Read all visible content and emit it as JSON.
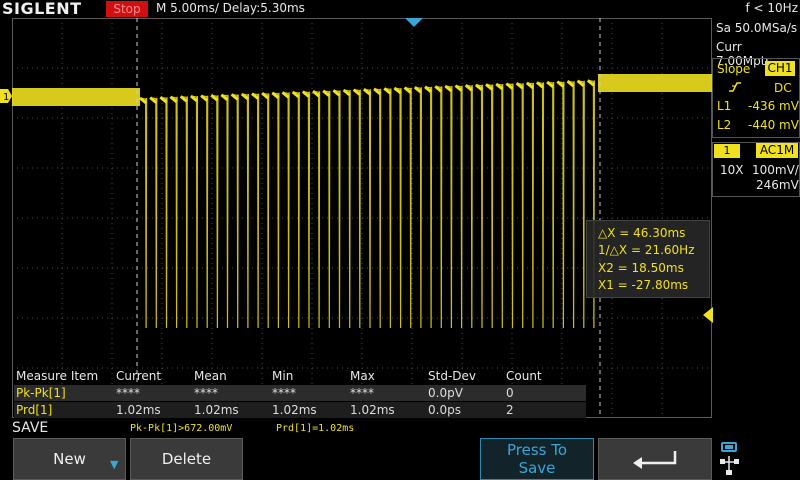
{
  "header": {
    "logo": "SIGLENT",
    "run_state": "Stop",
    "timebase": "M 5.00ms/ Delay:5.30ms",
    "trigger_freq": "f < 10Hz"
  },
  "acquisition": {
    "sample_rate": "Sa 50.0MSa/s",
    "memory_depth": "Curr 7.00Mpts"
  },
  "trigger": {
    "type": "Slope",
    "source": "CH1",
    "slope_icon": "rising-slope-icon",
    "coupling": "DC",
    "l1_label": "L1",
    "l1_value": "-436 mV",
    "l2_label": "L2",
    "l2_value": "-440 mV"
  },
  "channel": {
    "number": "1",
    "coupling": "AC1M",
    "probe": "10X",
    "scale": "100mV/",
    "offset": "246mV",
    "marker": "1"
  },
  "cursors": {
    "delta_x": "△X = 46.30ms",
    "inv_delta_x": "1/△X = 21.60Hz",
    "x2": "X2 = 18.50ms",
    "x1": "X1 = -27.80ms"
  },
  "measure": {
    "headers": [
      "Measure Item",
      "Current",
      "Mean",
      "Min",
      "Max",
      "Std-Dev",
      "Count"
    ],
    "rows": [
      {
        "item": "Pk-Pk[1]",
        "current": "****",
        "mean": "****",
        "min": "****",
        "max": "****",
        "std_dev": "0.0pV",
        "count": "0"
      },
      {
        "item": "Prd[1]",
        "current": "1.02ms",
        "mean": "1.02ms",
        "min": "1.02ms",
        "max": "1.02ms",
        "std_dev": "0.0ps",
        "count": "2"
      }
    ]
  },
  "status": {
    "menu_title": "SAVE",
    "quick_pkpk": "Pk-Pk[1]>672.00mV",
    "quick_prd": "Prd[1]=1.02ms"
  },
  "softkeys": {
    "new_label": "New",
    "delete_label": "Delete",
    "press_to_label": "Press To",
    "save_label": "Save",
    "return_icon": "return-arrow-icon",
    "usb_icon": "usb-network-icon"
  },
  "colors": {
    "trace": "#f0e020",
    "grid": "#5a5a5a",
    "stop": "#d01010",
    "accent": "#3aa6d8"
  },
  "waveform": {
    "pulse_period_ms": 1.02,
    "pulse_count": 45
  }
}
